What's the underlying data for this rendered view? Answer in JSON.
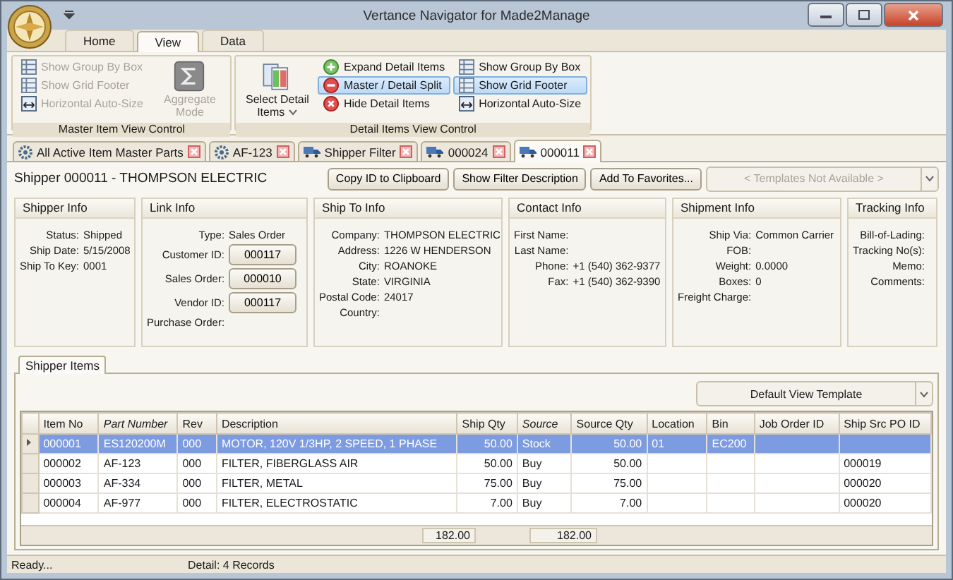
{
  "window": {
    "title": "Vertance Navigator for Made2Manage"
  },
  "ribbon": {
    "tabs": [
      {
        "label": "Home",
        "selected": false
      },
      {
        "label": "View",
        "selected": true
      },
      {
        "label": "Data",
        "selected": false
      }
    ],
    "groups": [
      {
        "label": "Master Item View Control",
        "controls": [
          {
            "kind": "stack",
            "items": [
              {
                "label": "Show Group By Box",
                "kind": "grid",
                "disabled": true,
                "selected": false
              },
              {
                "label": "Show Grid Footer",
                "kind": "grid",
                "disabled": true,
                "selected": false
              },
              {
                "label": "Horizontal Auto-Size",
                "kind": "resize",
                "disabled": true,
                "selected": false
              }
            ]
          },
          {
            "kind": "sigma",
            "label": "Aggregate Mode",
            "disabled": true
          }
        ]
      },
      {
        "label": "Detail Items View Control",
        "controls": [
          {
            "kind": "panes",
            "label": "Select Detail Items",
            "disabled": false,
            "dropdown": true
          },
          {
            "kind": "stack",
            "items": [
              {
                "label": "Expand Detail Items",
                "kind": "plus",
                "disabled": false,
                "selected": false
              },
              {
                "label": "Master / Detail Split",
                "kind": "minus",
                "disabled": false,
                "selected": true
              },
              {
                "label": "Hide Detail Items",
                "kind": "cross",
                "disabled": false,
                "selected": false
              }
            ]
          },
          {
            "kind": "stack",
            "items": [
              {
                "label": "Show Group By Box",
                "kind": "grid",
                "disabled": false,
                "selected": false
              },
              {
                "label": "Show Grid Footer",
                "kind": "grid",
                "disabled": false,
                "selected": true
              },
              {
                "label": "Horizontal Auto-Size",
                "kind": "resize",
                "disabled": false,
                "selected": false
              }
            ]
          }
        ]
      }
    ]
  },
  "doc_tabs": [
    {
      "label": "All Active Item Master Parts",
      "kind": "gear",
      "selected": false
    },
    {
      "label": "AF-123",
      "kind": "gear",
      "selected": false
    },
    {
      "label": "Shipper Filter",
      "kind": "truck",
      "selected": false
    },
    {
      "label": "000024",
      "kind": "truck",
      "selected": false
    },
    {
      "label": "000011",
      "kind": "truck",
      "selected": true
    }
  ],
  "header": {
    "title": "Shipper 000011 - THOMPSON ELECTRIC",
    "buttons": [
      "Copy ID to Clipboard",
      "Show Filter Description",
      "Add To Favorites..."
    ],
    "template_select": {
      "value": "< Templates Not Available >",
      "disabled": true
    }
  },
  "panels": [
    {
      "title": "Shipper Info",
      "fields": [
        {
          "label": "Status:",
          "value": "Shipped",
          "kind": "text"
        },
        {
          "label": "Ship Date:",
          "value": "5/15/2008",
          "kind": "text"
        },
        {
          "label": "Ship To Key:",
          "value": "0001",
          "kind": "text"
        }
      ]
    },
    {
      "title": "Link Info",
      "fields": [
        {
          "label": "Type:",
          "value": "Sales Order",
          "kind": "text"
        },
        {
          "label": "Customer ID:",
          "value": "000117",
          "kind": "button"
        },
        {
          "label": "Sales Order:",
          "value": "000010",
          "kind": "button"
        },
        {
          "label": "Vendor ID:",
          "value": "000117",
          "kind": "button"
        },
        {
          "label": "Purchase Order:"
        }
      ]
    },
    {
      "title": "Ship To Info",
      "fields": [
        {
          "label": "Company:",
          "value": "THOMPSON ELECTRIC",
          "kind": "text"
        },
        {
          "label": "Address:",
          "value": "1226 W HENDERSON",
          "kind": "text"
        },
        {
          "label": "City:",
          "value": "ROANOKE",
          "kind": "text"
        },
        {
          "label": "State:",
          "value": "VIRGINIA",
          "kind": "text"
        },
        {
          "label": "Postal Code:",
          "value": "24017",
          "kind": "text"
        },
        {
          "label": "Country:"
        }
      ]
    },
    {
      "title": "Contact Info",
      "fields": [
        {
          "label": "First Name:"
        },
        {
          "label": "Last Name:"
        },
        {
          "label": "Phone:",
          "value": "+1 (540) 362-9377",
          "kind": "text"
        },
        {
          "label": "Fax:",
          "value": "+1 (540) 362-9390",
          "kind": "text"
        }
      ]
    },
    {
      "title": "Shipment Info",
      "fields": [
        {
          "label": "Ship Via:",
          "value": "Common Carrier",
          "kind": "text"
        },
        {
          "label": "FOB:"
        },
        {
          "label": "Weight:",
          "value": "0.0000",
          "kind": "text"
        },
        {
          "label": "Boxes:",
          "value": "0",
          "kind": "text"
        },
        {
          "label": "Freight Charge:"
        }
      ]
    },
    {
      "title": "Tracking Info",
      "fields": [
        {
          "label": "Bill-of-Lading:"
        },
        {
          "label": "Tracking No(s):"
        },
        {
          "label": "Memo:"
        },
        {
          "label": "Comments:"
        }
      ]
    }
  ],
  "items_tab": {
    "label": "Shipper Items",
    "selected": true
  },
  "view_template": {
    "value": "Default View Template"
  },
  "grid": {
    "columns": [
      {
        "label": "Item No",
        "kind": "text",
        "italic": false
      },
      {
        "label": "Part Number",
        "kind": "text",
        "italic": true
      },
      {
        "label": "Rev",
        "kind": "text",
        "italic": false
      },
      {
        "label": "Description",
        "kind": "text",
        "italic": false
      },
      {
        "label": "Ship Qty",
        "kind": "number",
        "italic": false,
        "total": "182.00"
      },
      {
        "label": "Source",
        "kind": "text",
        "italic": true
      },
      {
        "label": "Source Qty",
        "kind": "number",
        "italic": false,
        "total": "182.00"
      },
      {
        "label": "Location",
        "kind": "text",
        "italic": false
      },
      {
        "label": "Bin",
        "kind": "text",
        "italic": false
      },
      {
        "label": "Job Order ID",
        "kind": "text",
        "italic": false
      },
      {
        "label": "Ship Src PO ID",
        "kind": "text",
        "italic": false
      }
    ],
    "rows": [
      {
        "selected": true,
        "cells": [
          "000001",
          "ES120200M",
          "000",
          "MOTOR, 120V 1/3HP, 2 SPEED, 1 PHASE",
          "50.00",
          "Stock",
          "50.00",
          "01",
          "EC200",
          null,
          null
        ]
      },
      {
        "selected": false,
        "cells": [
          "000002",
          "AF-123",
          "000",
          "FILTER, FIBERGLASS AIR",
          "50.00",
          "Buy",
          "50.00",
          null,
          null,
          null,
          "000019"
        ]
      },
      {
        "selected": false,
        "cells": [
          "000003",
          "AF-334",
          "000",
          "FILTER, METAL",
          "75.00",
          "Buy",
          "75.00",
          null,
          null,
          null,
          "000020"
        ]
      },
      {
        "selected": false,
        "cells": [
          "000004",
          "AF-977",
          "000",
          "FILTER, ELECTROSTATIC",
          "7.00",
          "Buy",
          "7.00",
          null,
          null,
          null,
          "000020"
        ]
      }
    ]
  },
  "status_bar": {
    "left": "Ready...",
    "detail": "Detail: 4 Records"
  }
}
